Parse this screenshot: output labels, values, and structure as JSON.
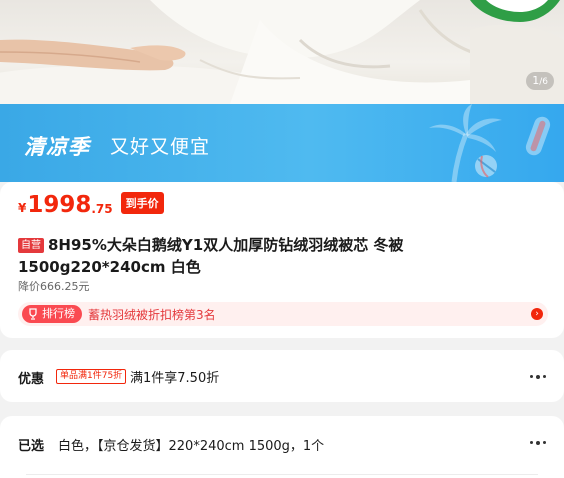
{
  "gallery": {
    "current_page": "1",
    "separator": "/",
    "total_pages": "6"
  },
  "promo": {
    "title": "清凉季",
    "subtitle": "又好又便宜"
  },
  "product": {
    "price_symbol": "¥",
    "price_integer": "1998",
    "price_decimal": ".75",
    "price_tag": "到手价",
    "self_operated_badge": "自营",
    "title": "8H95%大朵白鹅绒Y1双人加厚防钻绒羽绒被芯 冬被1500g220*240cm 白色",
    "drop_price_text": "降价666.25元",
    "ranking": {
      "badge": "排行榜",
      "text": "蓄热羽绒被折扣榜第3名"
    }
  },
  "discount": {
    "label": "优惠",
    "coupon_tag": "单品满1件75折",
    "text": "满1件享7.50折"
  },
  "selected": {
    "label": "已选",
    "text": "白色，【京仓发货】220*240cm 1500g，1个"
  },
  "colors": {
    "accent_red": "#f2270c",
    "promo_blue": "#3aa8e6",
    "rank_bg": "#fff0ef"
  }
}
